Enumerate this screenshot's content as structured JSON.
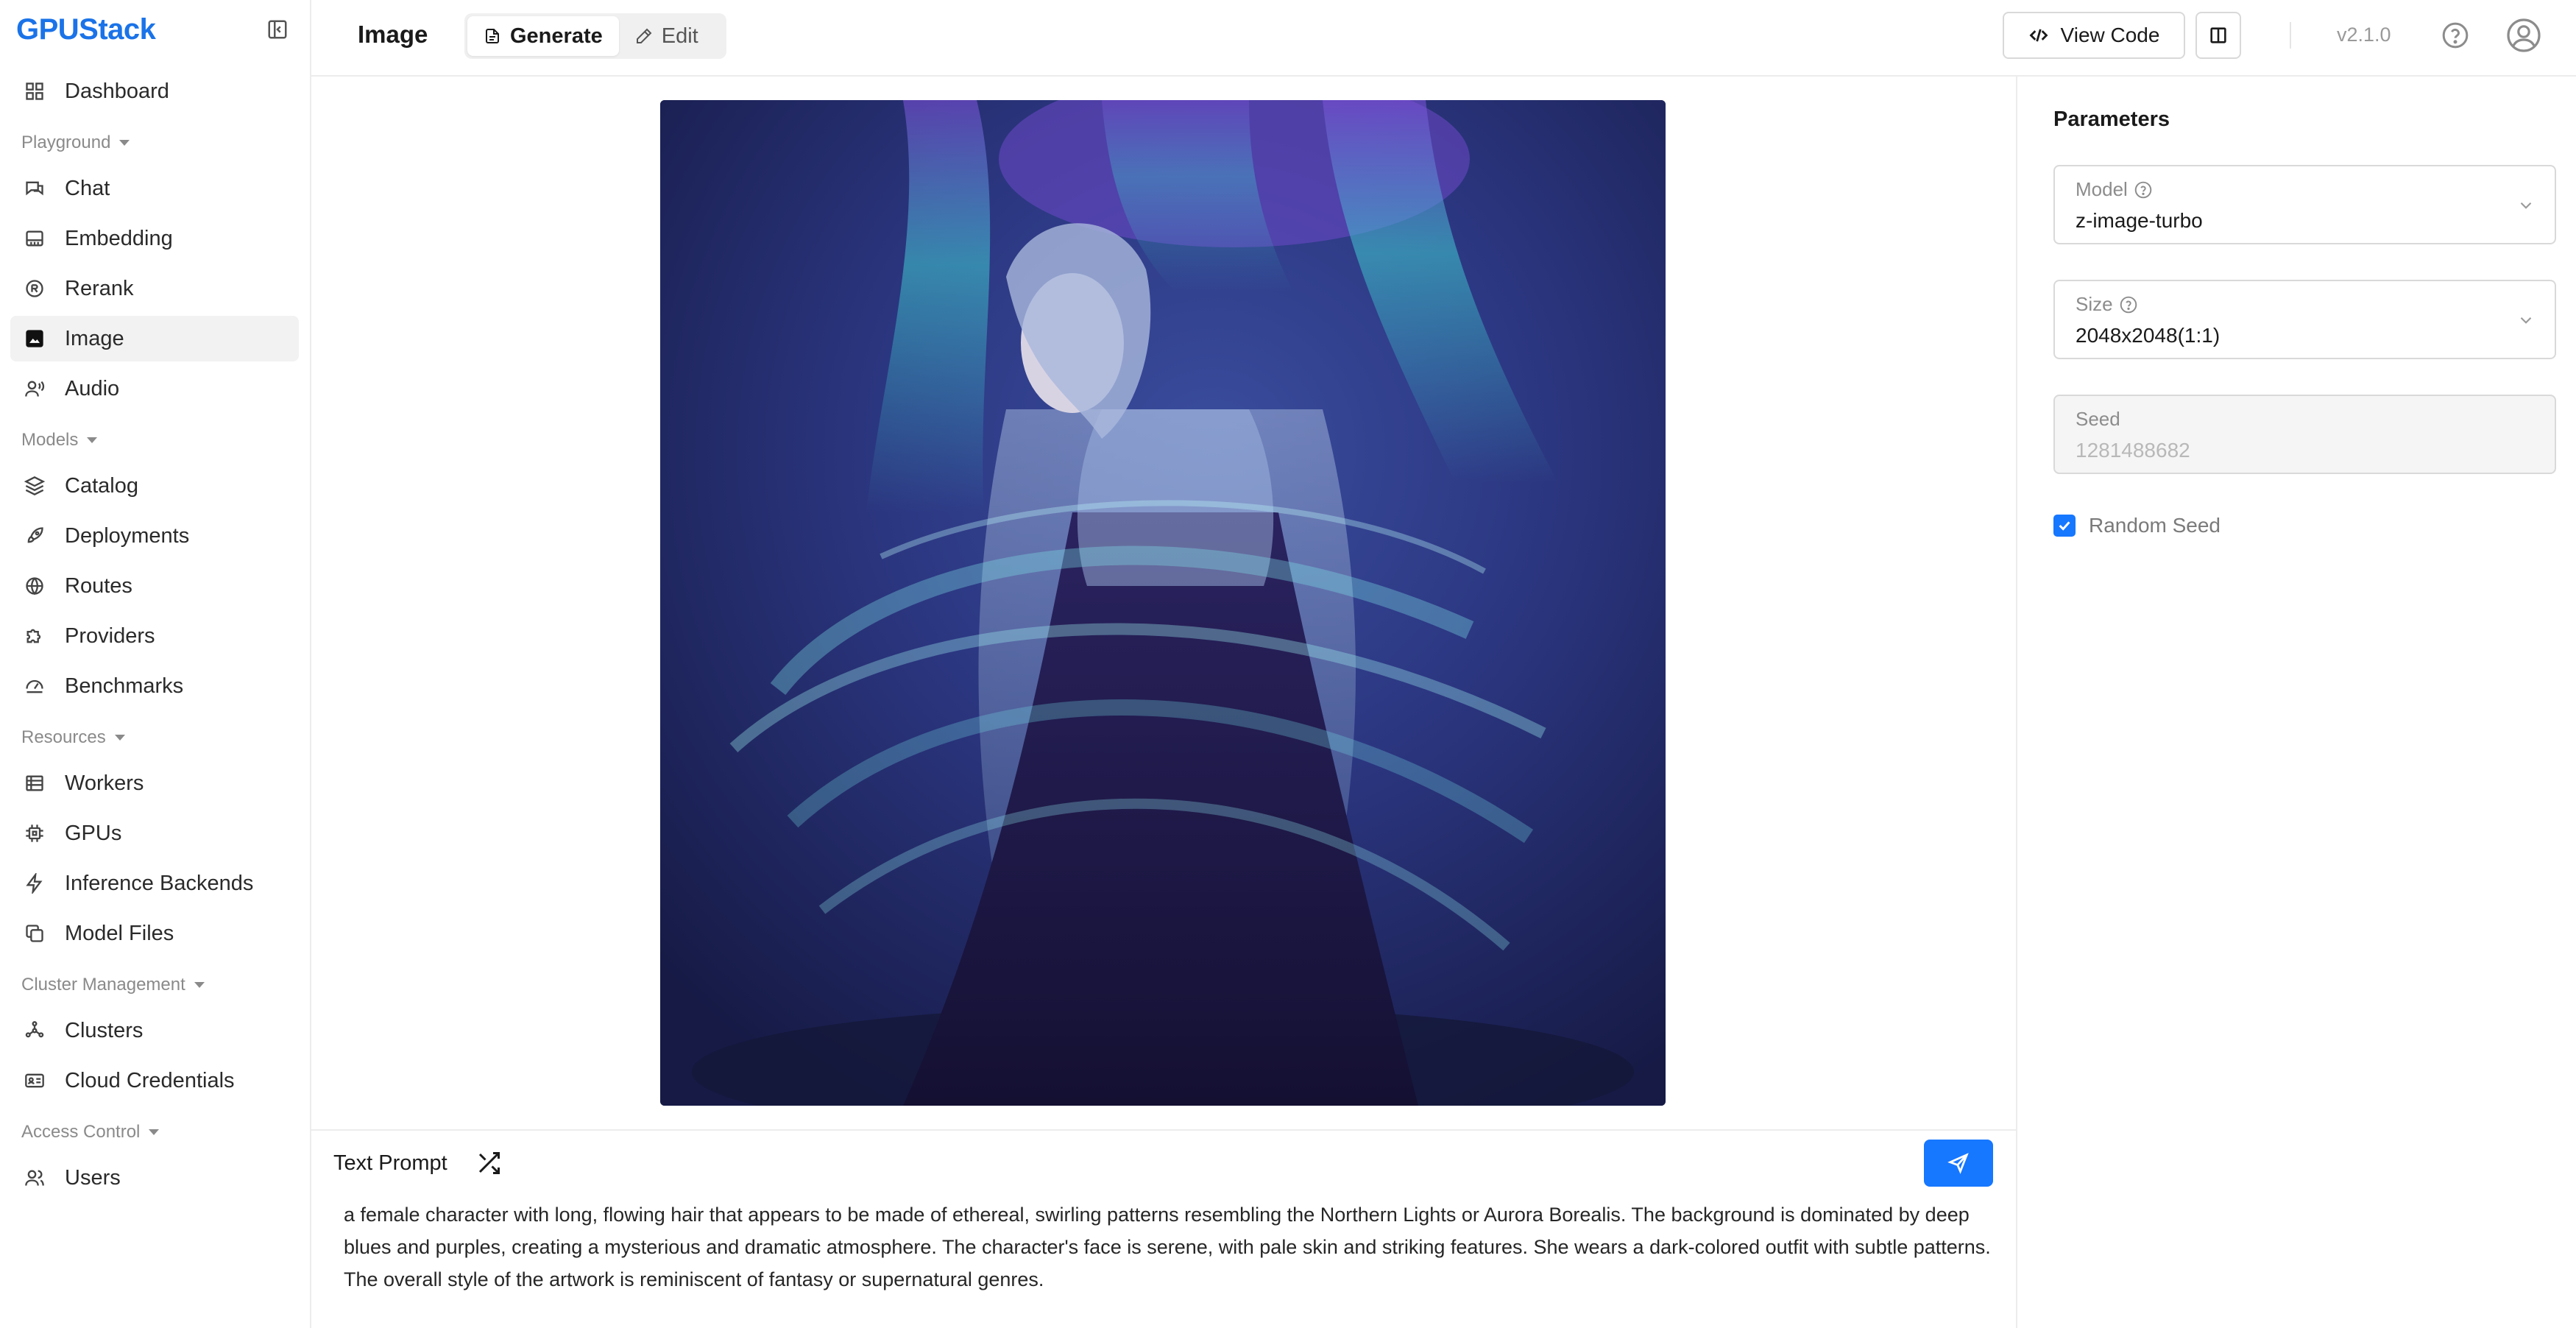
{
  "app": {
    "logo_text": "GPUStack"
  },
  "sidebar": {
    "items": {
      "dashboard": "Dashboard",
      "chat": "Chat",
      "embedding": "Embedding",
      "rerank": "Rerank",
      "image": "Image",
      "audio": "Audio",
      "catalog": "Catalog",
      "deployments": "Deployments",
      "routes": "Routes",
      "providers": "Providers",
      "benchmarks": "Benchmarks",
      "workers": "Workers",
      "gpus": "GPUs",
      "inference_backends": "Inference Backends",
      "model_files": "Model Files",
      "clusters": "Clusters",
      "cloud_credentials": "Cloud Credentials",
      "users": "Users"
    },
    "sections": {
      "playground": "Playground",
      "models": "Models",
      "resources": "Resources",
      "cluster_management": "Cluster Management",
      "access_control": "Access Control"
    },
    "active": "image"
  },
  "header": {
    "title": "Image",
    "tabs": {
      "generate": "Generate",
      "edit": "Edit"
    },
    "active_tab": "generate",
    "view_code_label": "View Code",
    "version": "v2.1.0"
  },
  "prompt": {
    "label": "Text Prompt",
    "text": "a female character with long, flowing hair that appears to be made of ethereal, swirling patterns resembling the Northern Lights or Aurora Borealis. The background is dominated by deep blues and purples, creating a mysterious and dramatic atmosphere. The character's face is serene, with pale skin and striking features. She wears a dark-colored outfit with subtle patterns. The overall style of the artwork is reminiscent of fantasy or supernatural genres."
  },
  "parameters": {
    "title": "Parameters",
    "model": {
      "label": "Model",
      "value": "z-image-turbo"
    },
    "size": {
      "label": "Size",
      "value": "2048x2048(1:1)"
    },
    "seed": {
      "label": "Seed",
      "value": "1281488682"
    },
    "random_seed": {
      "label": "Random Seed",
      "checked": true
    }
  },
  "colors": {
    "accent": "#1677ff",
    "brand": "#1a73e8"
  }
}
